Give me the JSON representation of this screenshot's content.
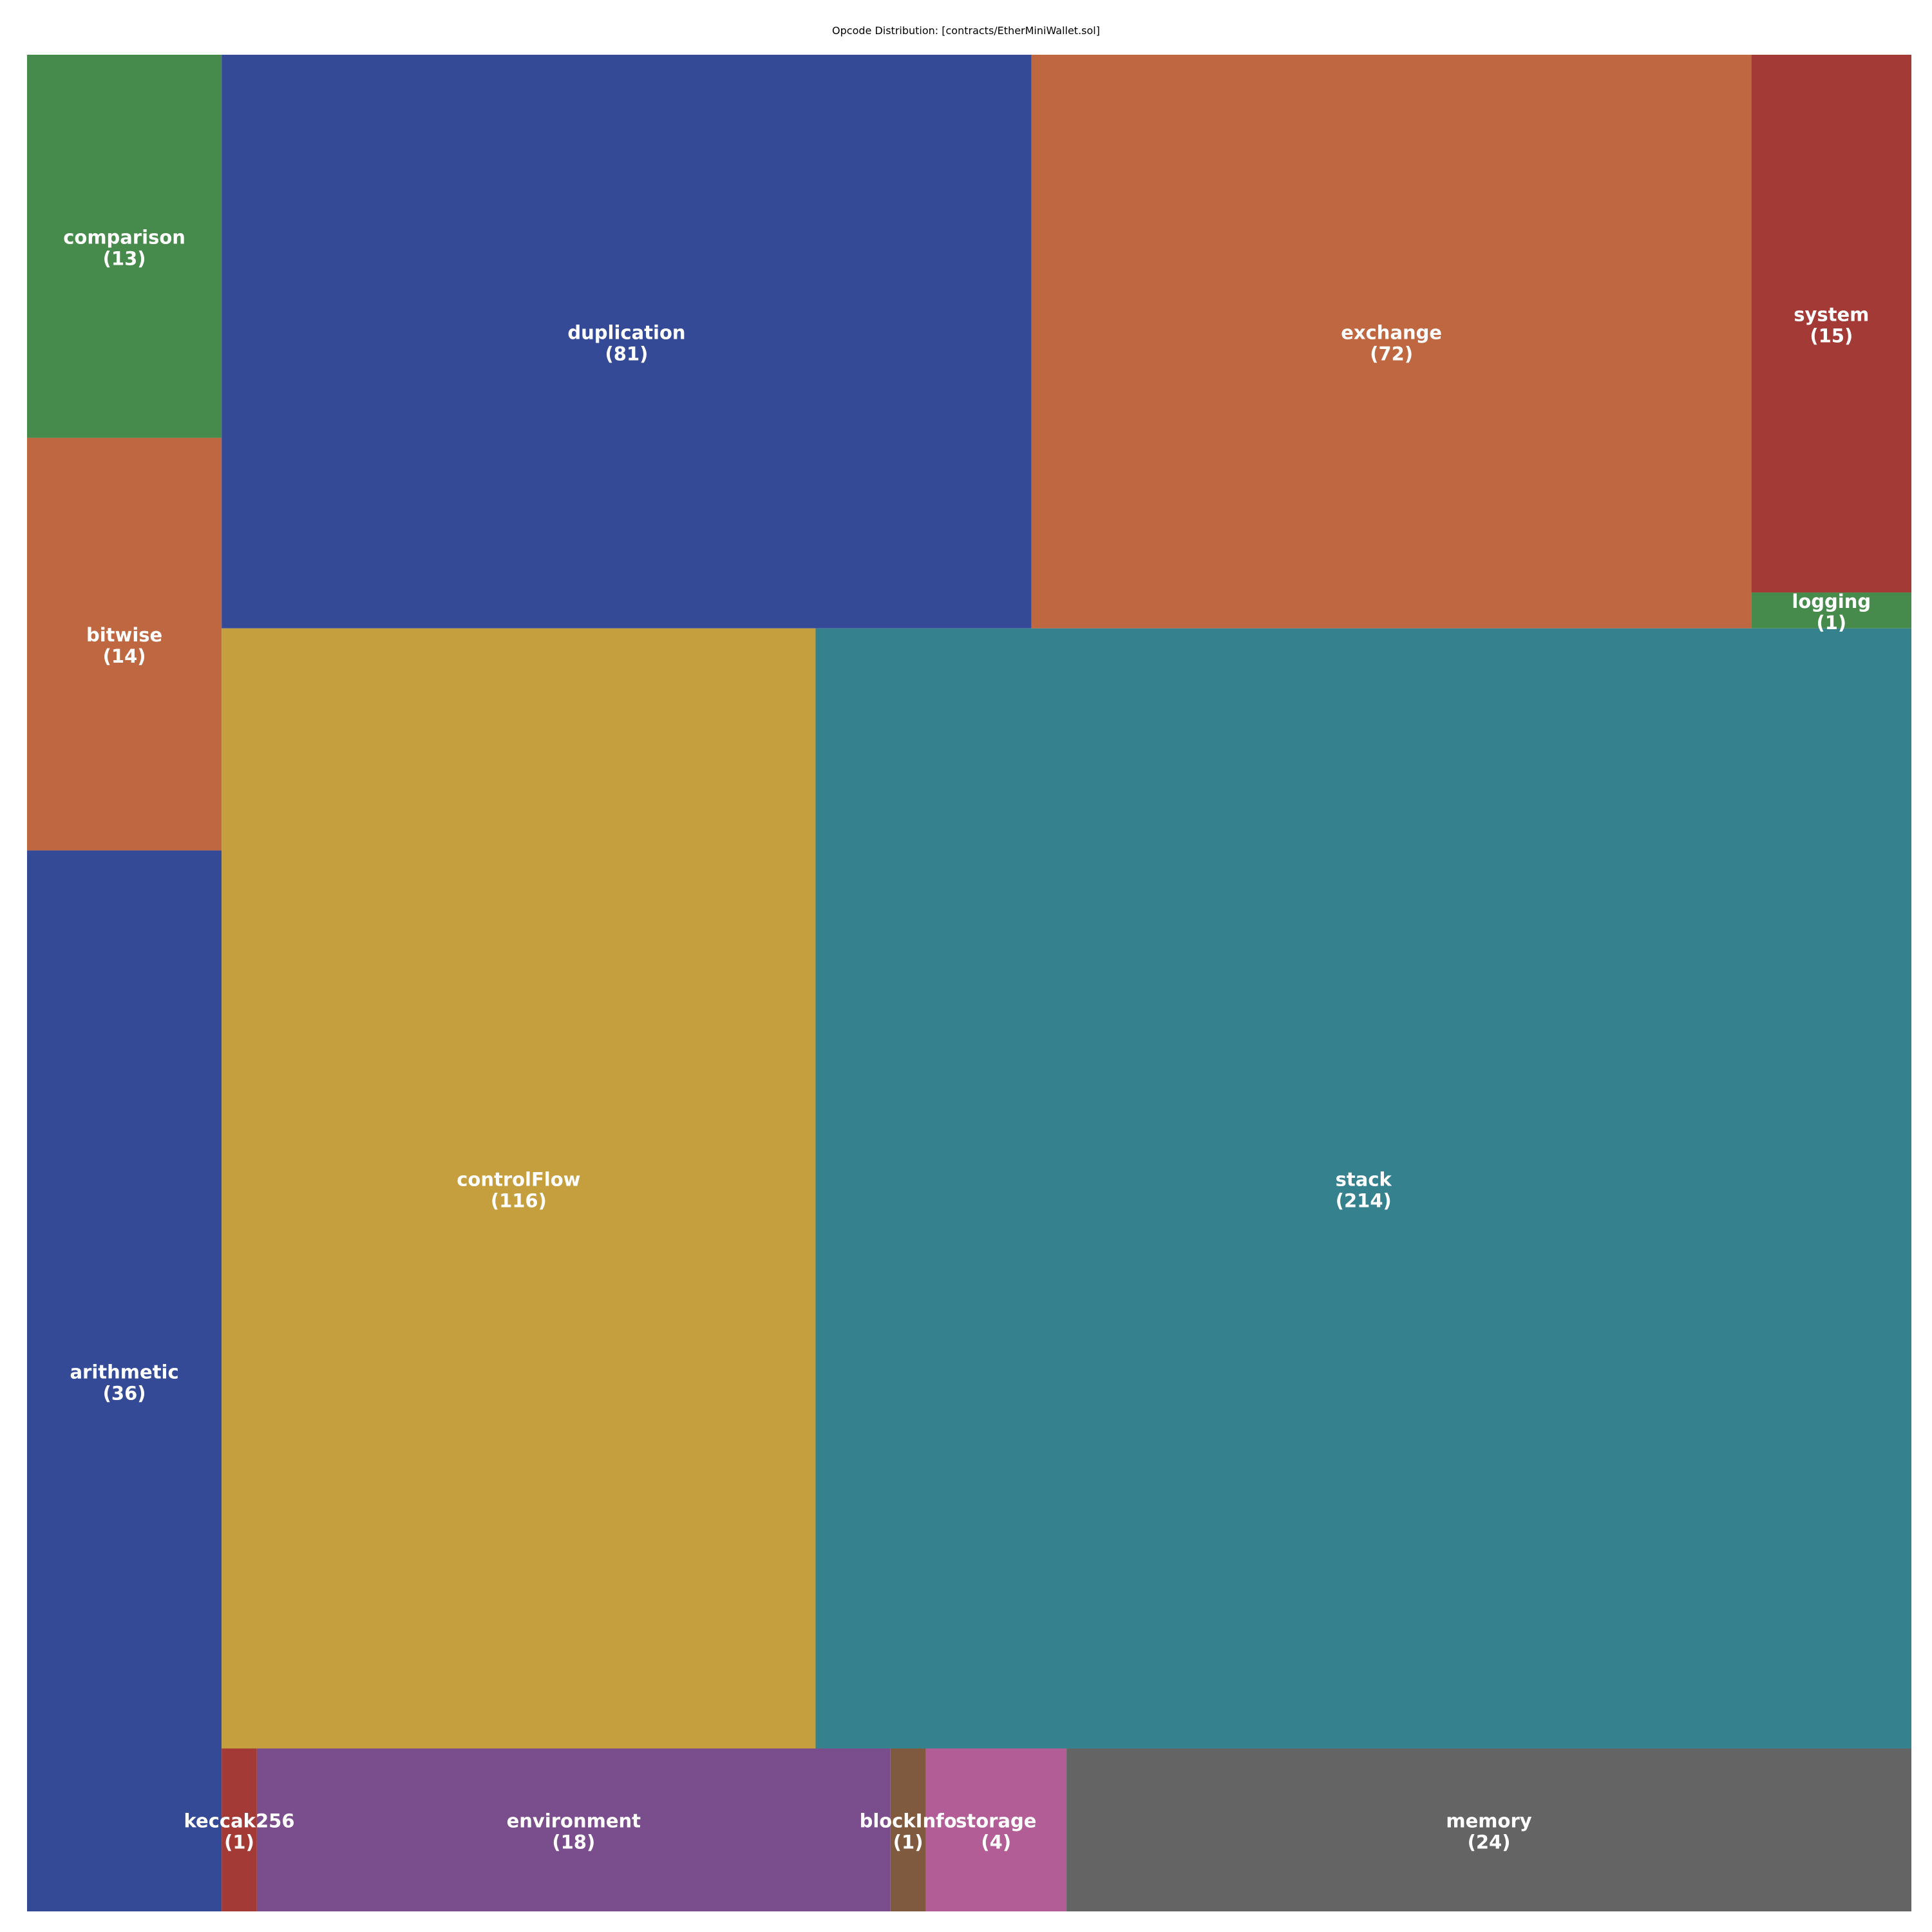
{
  "chart_data": {
    "type": "treemap",
    "title": "Opcode Distribution: [contracts/EtherMiniWallet.sol]",
    "label_color": "#ffffff",
    "categories": [
      {
        "name": "arithmetic",
        "value": 36,
        "color": "#344a97"
      },
      {
        "name": "bitwise",
        "value": 14,
        "color": "#bf6740"
      },
      {
        "name": "comparison",
        "value": 13,
        "color": "#468b4b"
      },
      {
        "name": "keccak256",
        "value": 1,
        "color": "#a33a36"
      },
      {
        "name": "environment",
        "value": 18,
        "color": "#7a4e8c"
      },
      {
        "name": "blockInfo",
        "value": 1,
        "color": "#7f5a3e"
      },
      {
        "name": "storage",
        "value": 4,
        "color": "#b35d96"
      },
      {
        "name": "memory",
        "value": 24,
        "color": "#646464"
      },
      {
        "name": "controlFlow",
        "value": 116,
        "color": "#c59e3d"
      },
      {
        "name": "stack",
        "value": 214,
        "color": "#35818d"
      },
      {
        "name": "duplication",
        "value": 81,
        "color": "#344a97"
      },
      {
        "name": "exchange",
        "value": 72,
        "color": "#bf6740"
      },
      {
        "name": "logging",
        "value": 1,
        "color": "#468b4b"
      },
      {
        "name": "system",
        "value": 15,
        "color": "#a33a36"
      }
    ]
  }
}
